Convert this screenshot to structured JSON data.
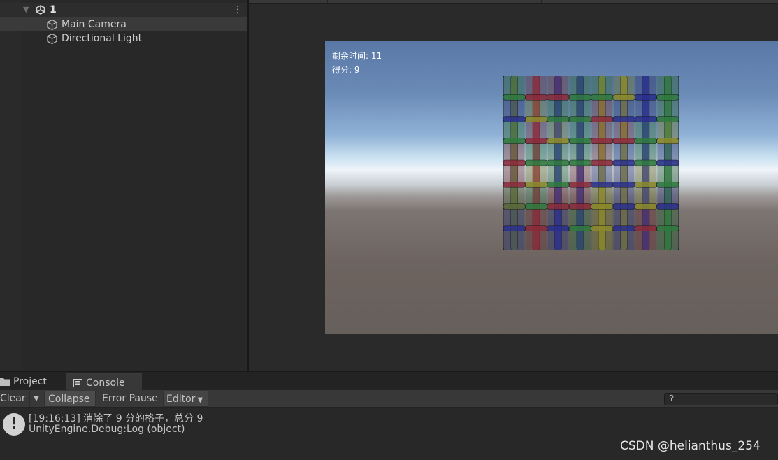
{
  "hierarchy": {
    "scene_name": "1",
    "scene_menu_glyph": "⋮",
    "fold_glyph": "▼",
    "items": [
      {
        "label": "Main Camera",
        "icon": "gameobject-cube-icon",
        "selected": true
      },
      {
        "label": "Directional Light",
        "icon": "gameobject-cube-icon",
        "selected": false
      }
    ]
  },
  "game": {
    "hud_time": "剩余时间: 11",
    "hud_score": "得分: 9",
    "board": {
      "rows": 8,
      "cols": 8,
      "vertical_colors": [
        "olive",
        "red",
        "blue",
        "blue",
        "yellow",
        "yellow",
        "blue",
        "green"
      ],
      "horizontal_colors": [
        [
          "green",
          "red",
          "red",
          "green",
          "green",
          "yellow",
          "blue",
          "green"
        ],
        [
          "blue",
          "yellow",
          "green",
          "green",
          "red",
          "blue",
          "blue",
          "green"
        ],
        [
          "green",
          "red",
          "yellow",
          "green",
          "red",
          "red",
          "green",
          "yellow"
        ],
        [
          "red",
          "green",
          "green",
          "green",
          "red",
          "blue",
          "green",
          "blue"
        ],
        [
          "red",
          "yellow",
          "green",
          "red",
          "blue",
          "blue",
          "yellow",
          "green"
        ],
        [
          "olive",
          "green",
          "red",
          "red",
          "yellow",
          "blue",
          "yellow",
          "blue"
        ],
        [
          "blue",
          "red",
          "blue",
          "green",
          "yellow",
          "blue",
          "red",
          "green"
        ]
      ],
      "palette": {
        "red": "#8c2a3a",
        "green": "#2f7a3e",
        "blue": "#2a2f8c",
        "yellow": "#8c8a2a",
        "olive": "#5a6a3a"
      }
    }
  },
  "bottom": {
    "tabs": [
      {
        "label": "Project",
        "icon": "folder-icon",
        "active": false
      },
      {
        "label": "Console",
        "icon": "console-icon",
        "active": true
      }
    ],
    "toolbar": {
      "clear": "Clear",
      "clear_menu_glyph": "▼",
      "collapse": "Collapse",
      "error_pause": "Error Pause",
      "editor": "Editor",
      "editor_caret": "▼",
      "search_icon": "⚲",
      "search_value": ""
    },
    "log": {
      "icon": "info-message-icon",
      "icon_glyph": "!",
      "line1": "[19:16:13] 消除了 9 分的格子，总分 9",
      "line2": "UnityEngine.Debug:Log (object)"
    }
  },
  "watermark": "CSDN @helianthus_254",
  "colors": {
    "panel_bg": "#282828",
    "toolbar_bg": "#383838",
    "selection_bg": "#3a3a3a",
    "text": "#c4c4c4"
  }
}
